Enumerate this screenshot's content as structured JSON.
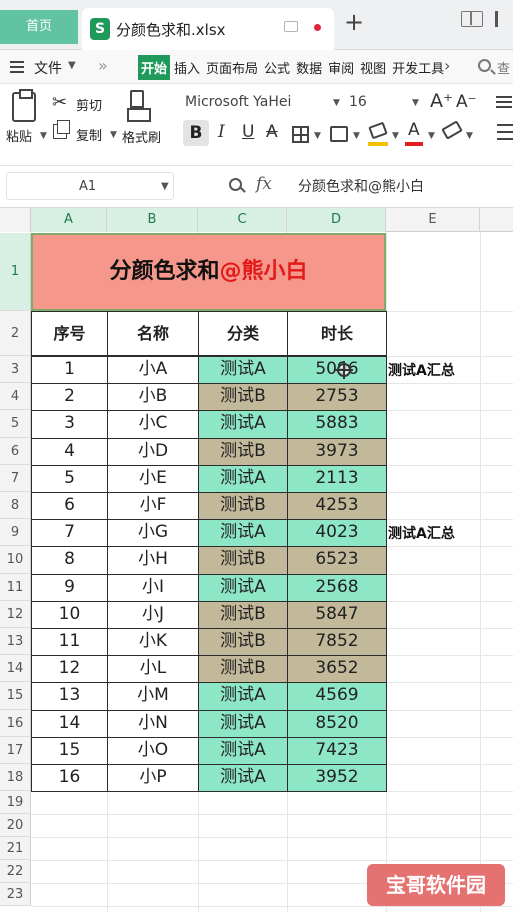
{
  "titlebar": {
    "home_tab": "首页",
    "doc_icon": "S",
    "doc_name": "分颜色求和.xlsx",
    "new_tab": "+"
  },
  "menubar": {
    "file_label": "文件",
    "items": [
      "开始",
      "插入",
      "页面布局",
      "公式",
      "数据",
      "审阅",
      "视图",
      "开发工具"
    ],
    "active_item": "开始",
    "search_label": "查"
  },
  "toolbar": {
    "paste_label": "粘贴",
    "cut_label": "剪切",
    "copy_label": "复制",
    "format_painter_label": "格式刷",
    "font_name": "Microsoft YaHei",
    "font_size": "16",
    "bold": "B",
    "italic": "I",
    "underline": "U",
    "strike": "A",
    "font_color": "A"
  },
  "formulabar": {
    "cell_ref": "A1",
    "fx": "fx",
    "value": "分颜色求和@熊小白"
  },
  "grid": {
    "columns": [
      "A",
      "B",
      "C",
      "D",
      "E"
    ],
    "selected_columns": [
      "A",
      "B",
      "C",
      "D"
    ],
    "rows": [
      "1",
      "2",
      "3",
      "4",
      "5",
      "6",
      "7",
      "8",
      "9",
      "10",
      "11",
      "12",
      "13",
      "14",
      "15",
      "16",
      "17",
      "18",
      "19",
      "20",
      "21",
      "22",
      "23"
    ]
  },
  "sheet": {
    "title_black": "分颜色求和",
    "title_red": "@熊小白",
    "headers": [
      "序号",
      "名称",
      "分类",
      "时长"
    ],
    "records": [
      {
        "no": "1",
        "name": "小A",
        "cat": "测试A",
        "dur": "5096"
      },
      {
        "no": "2",
        "name": "小B",
        "cat": "测试B",
        "dur": "2753"
      },
      {
        "no": "3",
        "name": "小C",
        "cat": "测试A",
        "dur": "5883"
      },
      {
        "no": "4",
        "name": "小D",
        "cat": "测试B",
        "dur": "3973"
      },
      {
        "no": "5",
        "name": "小E",
        "cat": "测试A",
        "dur": "2113"
      },
      {
        "no": "6",
        "name": "小F",
        "cat": "测试B",
        "dur": "4253"
      },
      {
        "no": "7",
        "name": "小G",
        "cat": "测试A",
        "dur": "4023"
      },
      {
        "no": "8",
        "name": "小H",
        "cat": "测试B",
        "dur": "6523"
      },
      {
        "no": "9",
        "name": "小I",
        "cat": "测试A",
        "dur": "2568"
      },
      {
        "no": "10",
        "name": "小J",
        "cat": "测试B",
        "dur": "5847"
      },
      {
        "no": "11",
        "name": "小K",
        "cat": "测试B",
        "dur": "7852"
      },
      {
        "no": "12",
        "name": "小L",
        "cat": "测试B",
        "dur": "3652"
      },
      {
        "no": "13",
        "name": "小M",
        "cat": "测试A",
        "dur": "4569"
      },
      {
        "no": "14",
        "name": "小N",
        "cat": "测试A",
        "dur": "8520"
      },
      {
        "no": "15",
        "name": "小O",
        "cat": "测试A",
        "dur": "7423"
      },
      {
        "no": "16",
        "name": "小P",
        "cat": "测试A",
        "dur": "3952"
      }
    ],
    "summary_labels": [
      "测试A汇总",
      "测试A汇总"
    ]
  },
  "colors": {
    "title_fill": "#f6978c",
    "title_red_text": "#e21a1a",
    "category_a_fill": "#8de7c7",
    "category_b_fill": "#c2b99a",
    "accent_green": "#1f9a5b"
  },
  "watermark": "宝哥软件园"
}
